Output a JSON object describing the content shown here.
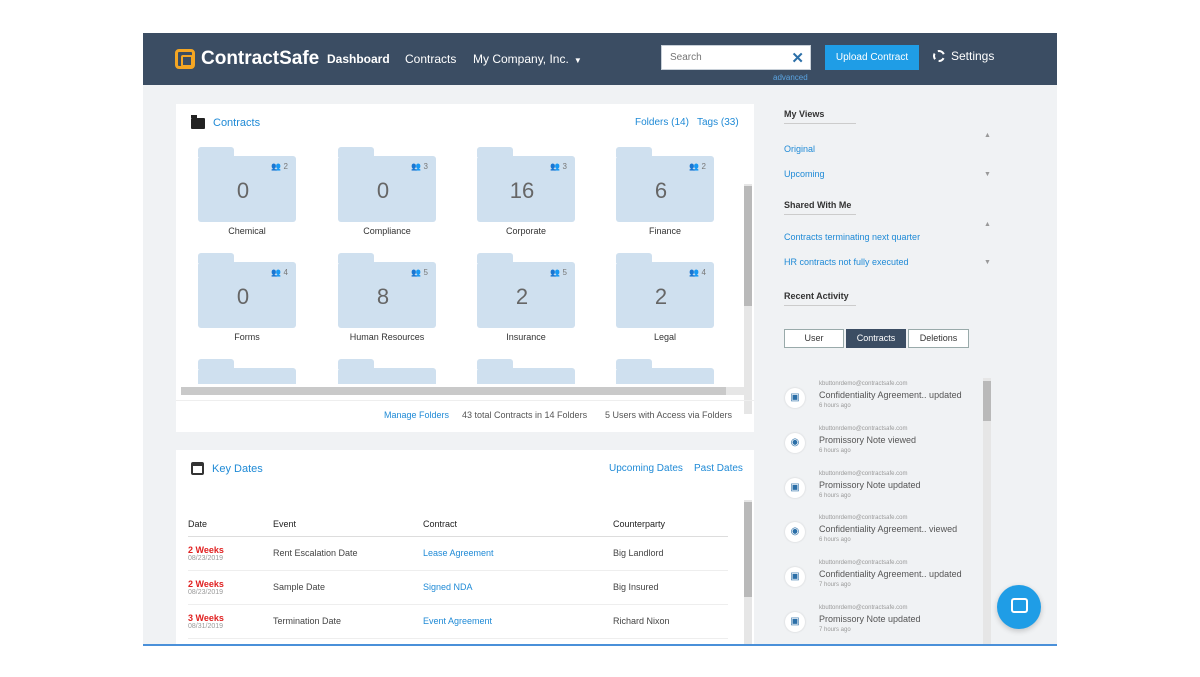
{
  "header": {
    "brand": "ContractSafe",
    "nav": {
      "dashboard": "Dashboard",
      "contracts": "Contracts",
      "company": "My Company, Inc."
    },
    "search_placeholder": "Search",
    "advanced": "advanced",
    "upload": "Upload Contract",
    "settings": "Settings"
  },
  "contracts_panel": {
    "title": "Contracts",
    "folders_link": "Folders (14)",
    "tags_link": "Tags (33)",
    "folders": [
      {
        "name": "Chemical",
        "count": "0",
        "users": "2"
      },
      {
        "name": "Compliance",
        "count": "0",
        "users": "3"
      },
      {
        "name": "Corporate",
        "count": "16",
        "users": "3"
      },
      {
        "name": "Finance",
        "count": "6",
        "users": "2"
      },
      {
        "name": "Forms",
        "count": "0",
        "users": "4"
      },
      {
        "name": "Human Resources",
        "count": "8",
        "users": "5"
      },
      {
        "name": "Insurance",
        "count": "2",
        "users": "5"
      },
      {
        "name": "Legal",
        "count": "2",
        "users": "4"
      }
    ],
    "footer": {
      "manage": "Manage Folders",
      "total": "43 total Contracts in 14 Folders",
      "users": "5 Users with Access via Folders"
    }
  },
  "key_dates": {
    "title": "Key Dates",
    "upcoming": "Upcoming Dates",
    "past": "Past Dates",
    "columns": [
      "Date",
      "Event",
      "Contract",
      "Counterparty"
    ],
    "rows": [
      {
        "weeks": "2 Weeks",
        "date": "08/23/2019",
        "event": "Rent Escalation Date",
        "contract": "Lease Agreement",
        "counterparty": "Big Landlord"
      },
      {
        "weeks": "2 Weeks",
        "date": "08/23/2019",
        "event": "Sample Date",
        "contract": "Signed NDA",
        "counterparty": "Big Insured"
      },
      {
        "weeks": "3 Weeks",
        "date": "08/31/2019",
        "event": "Termination Date",
        "contract": "Event Agreement",
        "counterparty": "Richard Nixon"
      }
    ]
  },
  "sidebar": {
    "my_views": "My Views",
    "views": [
      "Original",
      "Upcoming"
    ],
    "shared": "Shared With Me",
    "shared_views": [
      "Contracts terminating next quarter",
      "HR contracts not fully executed"
    ],
    "recent": "Recent Activity",
    "tabs": [
      "User",
      "Contracts",
      "Deletions"
    ],
    "activity": [
      {
        "email": "kbuttonrdemo@contractsafe.com",
        "text": "Confidentiality Agreement.. updated",
        "time": "6 hours ago",
        "icon": "doc"
      },
      {
        "email": "kbuttonrdemo@contractsafe.com",
        "text": "Promissory Note viewed",
        "time": "6 hours ago",
        "icon": "view"
      },
      {
        "email": "kbuttonrdemo@contractsafe.com",
        "text": "Promissory Note updated",
        "time": "6 hours ago",
        "icon": "doc"
      },
      {
        "email": "kbuttonrdemo@contractsafe.com",
        "text": "Confidentiality Agreement.. viewed",
        "time": "6 hours ago",
        "icon": "view"
      },
      {
        "email": "kbuttonrdemo@contractsafe.com",
        "text": "Confidentiality Agreement.. updated",
        "time": "7 hours ago",
        "icon": "doc"
      },
      {
        "email": "kbuttonrdemo@contractsafe.com",
        "text": "Promissory Note updated",
        "time": "7 hours ago",
        "icon": "doc"
      }
    ]
  },
  "colors": {
    "header": "#3b4d63",
    "accent": "#1f9de6",
    "folder": "#cfe0ef",
    "alert": "#e02020"
  }
}
